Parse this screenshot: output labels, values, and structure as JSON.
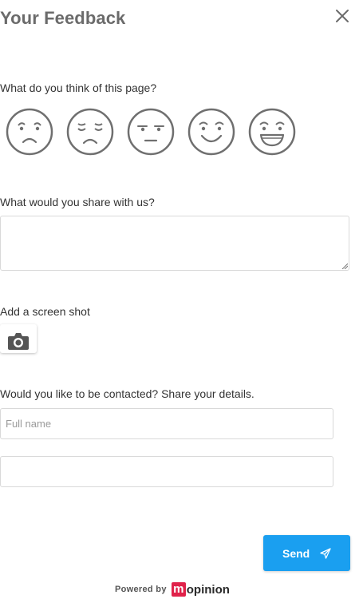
{
  "header": {
    "title": "Your Feedback",
    "close_icon": "close-icon"
  },
  "rating": {
    "question": "What do you think of this page?",
    "options": [
      {
        "name": "very-unhappy",
        "icon": "frown-smiley-icon"
      },
      {
        "name": "unhappy",
        "icon": "sad-smiley-icon"
      },
      {
        "name": "neutral",
        "icon": "neutral-smiley-icon"
      },
      {
        "name": "happy",
        "icon": "smile-smiley-icon"
      },
      {
        "name": "very-happy",
        "icon": "grin-smiley-icon"
      }
    ]
  },
  "comment": {
    "question": "What would you share with us?",
    "value": "",
    "placeholder": ""
  },
  "screenshot": {
    "label": "Add a screen shot",
    "icon": "camera-icon"
  },
  "contact": {
    "question": "Would you like to be contacted? Share your details.",
    "name_placeholder": "Full name",
    "name_value": "",
    "email_placeholder": "",
    "email_value": ""
  },
  "actions": {
    "send_label": "Send",
    "send_icon": "paper-plane-icon"
  },
  "footer": {
    "powered_label": "Powered by",
    "logo_letter": "m",
    "logo_rest": "opinion"
  },
  "colors": {
    "accent": "#1a9ff0",
    "brand": "#e0224a",
    "icon_gray": "#6f6f6f",
    "border": "#d9d9d9"
  }
}
